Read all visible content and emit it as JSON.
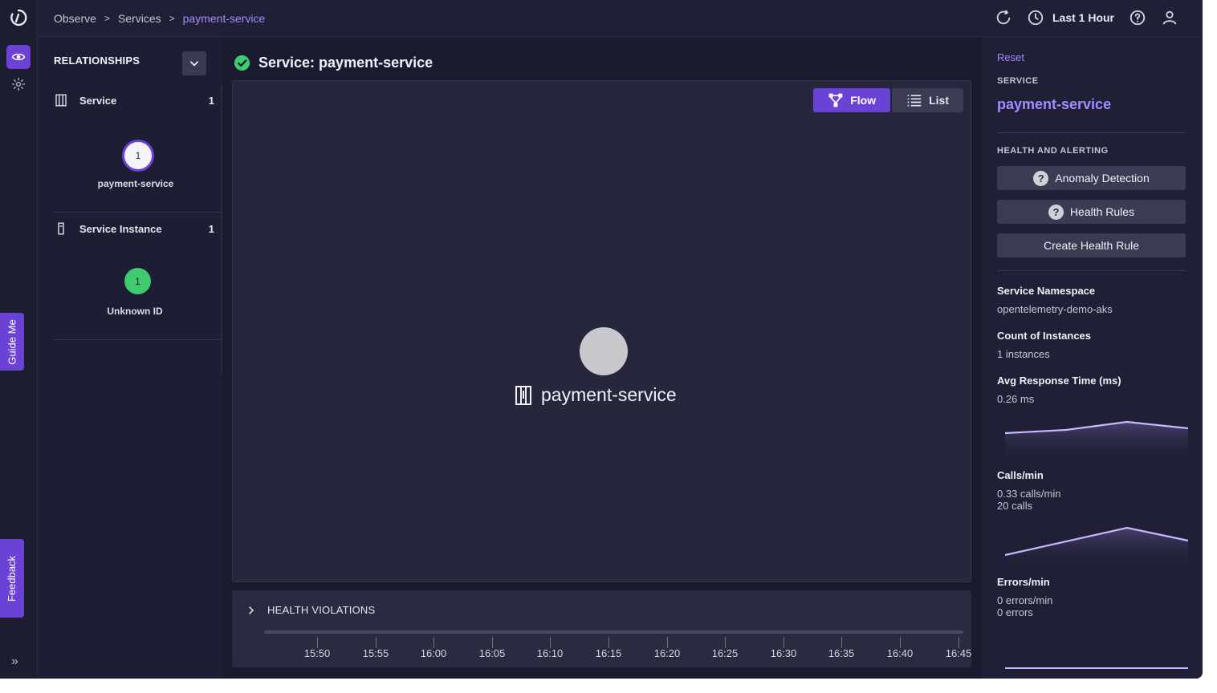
{
  "guide_label": "Guide Me",
  "feedback_label": "Feedback",
  "breadcrumb": [
    "Observe",
    "Services",
    "payment-service"
  ],
  "topbar": {
    "time_range": "Last 1 Hour"
  },
  "relationships": {
    "title": "RELATIONSHIPS",
    "groups": [
      {
        "label": "Service",
        "count": "1",
        "node_value": "1",
        "node_label": "payment-service"
      },
      {
        "label": "Service Instance",
        "count": "1",
        "node_value": "1",
        "node_label": "Unknown ID"
      }
    ]
  },
  "main": {
    "title": "Service: payment-service",
    "view_flow": "Flow",
    "view_list": "List",
    "node_label": "payment-service"
  },
  "violations": {
    "title": "HEALTH VIOLATIONS",
    "ticks": [
      "15:50",
      "15:55",
      "16:00",
      "16:05",
      "16:10",
      "16:15",
      "16:20",
      "16:25",
      "16:30",
      "16:35",
      "16:40",
      "16:45"
    ]
  },
  "details": {
    "reset": "Reset",
    "service_caption": "SERVICE",
    "service_name": "payment-service",
    "health_caption": "HEALTH AND ALERTING",
    "anomaly_button": "Anomaly Detection",
    "health_rules_button": "Health Rules",
    "create_rule_button": "Create Health Rule",
    "namespace_label": "Service Namespace",
    "namespace_value": "opentelemetry-demo-aks",
    "instances_label": "Count of Instances",
    "instances_value": "1 instances",
    "response_label": "Avg Response Time (ms)",
    "response_value": "0.26 ms",
    "calls_label": "Calls/min",
    "calls_value": "0.33 calls/min",
    "calls_total": "20 calls",
    "errors_label": "Errors/min",
    "errors_value": "0 errors/min",
    "errors_total": "0 errors"
  },
  "colors": {
    "accent": "#6a42d6",
    "link": "#a48bff",
    "healthy": "#3ecb6f",
    "background": "#1a1b2e"
  }
}
